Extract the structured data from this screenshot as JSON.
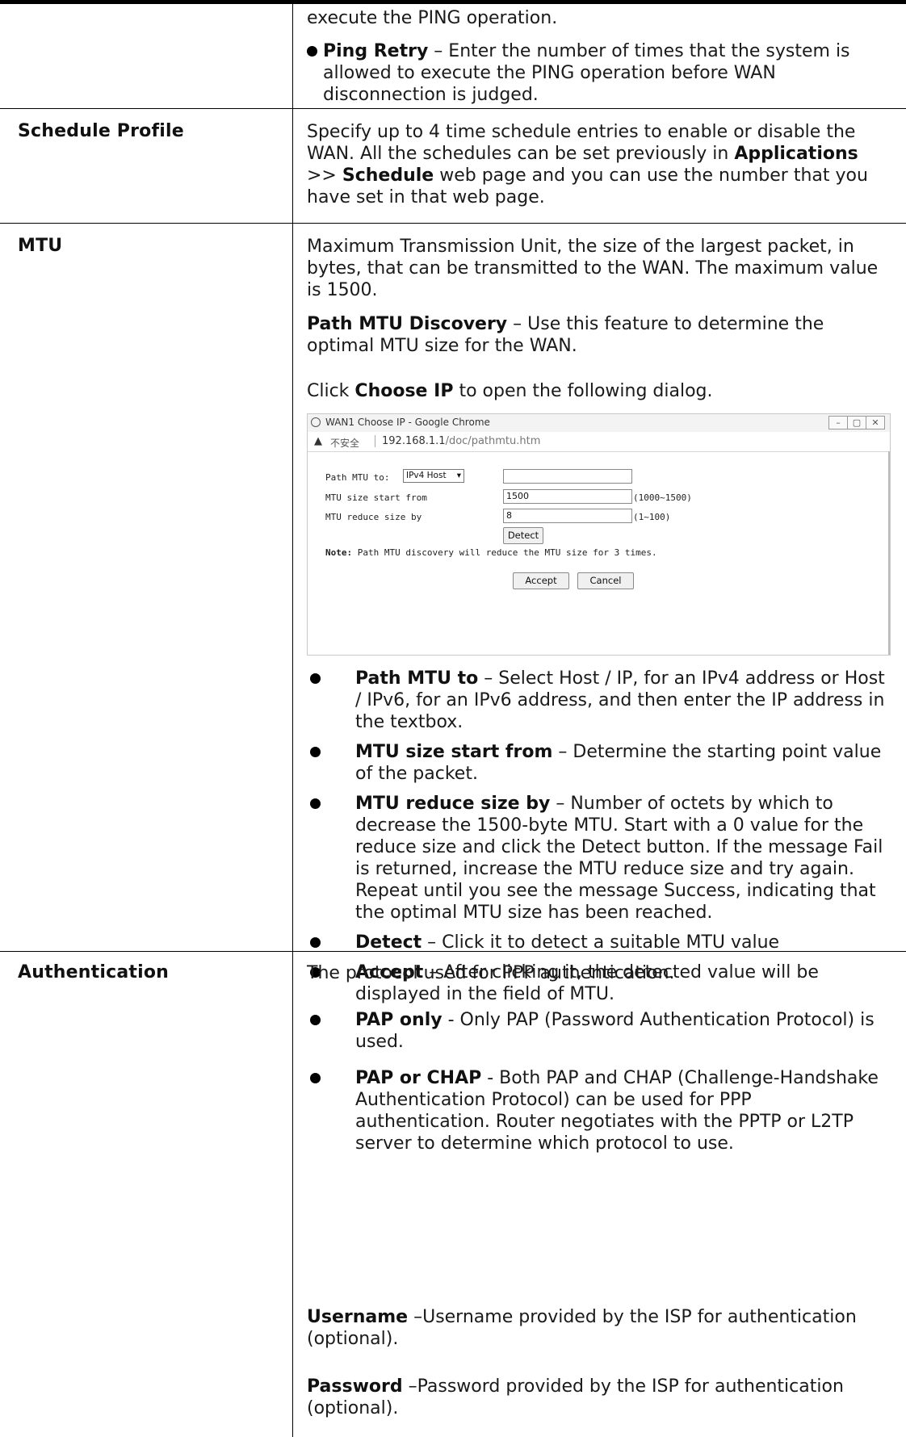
{
  "top_continuation": {
    "line1": "execute the PING operation.",
    "ping_retry_term": "Ping Retry",
    "ping_retry_desc": " – Enter the number of times that the system is allowed to execute the PING operation before WAN disconnection is judged."
  },
  "schedule": {
    "label": "Schedule Profile",
    "desc_a": "Specify up to 4 time schedule entries to enable or disable the WAN. All the schedules can be set previously in ",
    "desc_b1": "Applications",
    "desc_c": " >> ",
    "desc_b2": "Schedule",
    "desc_d": " web page and you can use the number that you have set in that web page."
  },
  "mtu": {
    "label": "MTU",
    "desc": "Maximum Transmission Unit, the size of the largest packet, in bytes, that can be transmitted to the WAN. The maximum value is 1500.",
    "pmd_term": "Path MTU Discovery",
    "pmd_desc": " – Use this feature to determine the optimal MTU size for the WAN.",
    "click_a": "Click ",
    "click_b": "Choose IP",
    "click_c": " to open the following dialog.",
    "dialog": {
      "title": "WAN1 Choose IP - Google Chrome",
      "insecure": "不安全",
      "url_host": "192.168.1.1",
      "url_path": "/doc/pathmtu.htm",
      "path_mtu_to_label": "Path MTU to:",
      "path_mtu_to_select": "IPv4 Host",
      "path_mtu_to_value": "",
      "start_label": "MTU size start from",
      "start_value": "1500",
      "start_range": "(1000~1500)",
      "reduce_label": "MTU reduce size by",
      "reduce_value": "8",
      "reduce_range": "(1~100)",
      "detect_btn": "Detect",
      "note_term": "Note:",
      "note_text": " Path MTU discovery will reduce the MTU size for 3 times.",
      "accept_btn": "Accept",
      "cancel_btn": "Cancel"
    },
    "bullets": [
      {
        "term": "Path MTU to",
        "desc": " – Select Host / IP, for an IPv4 address or Host / IPv6, for an IPv6 address, and then enter the IP address in the textbox."
      },
      {
        "term": "MTU size start from",
        "desc": " – Determine the starting point value of the packet."
      },
      {
        "term": "MTU reduce size by",
        "desc": " – Number of octets by which to decrease the 1500-byte MTU. Start with a 0 value for the reduce size and click the Detect button. If the message Fail is returned, increase the MTU reduce size and try again. Repeat until you see the message Success, indicating that the optimal MTU size has been reached."
      },
      {
        "term": "Detect",
        "desc": " – Click it to detect a suitable MTU value"
      },
      {
        "term": "Accept",
        "desc": " – After clicking it, the detected value will be displayed in the field of MTU."
      }
    ]
  },
  "auth": {
    "label": "Authentication",
    "desc": "The protocol used for PPP authentication.",
    "bullets": [
      {
        "term": "PAP only",
        "desc": " - Only PAP (Password Authentication Protocol) is used."
      },
      {
        "term": "PAP or CHAP",
        "desc": " - Both PAP and CHAP (Challenge-Handshake Authentication Protocol) can be used for PPP authentication. Router negotiates with the PPTP or L2TP server to determine which protocol to use."
      }
    ],
    "username_term": "Username",
    "username_desc": " –Username provided by the ISP for authentication (optional).",
    "password_term": "Password",
    "password_desc": " –Password provided by the ISP for authentication (optional)."
  }
}
